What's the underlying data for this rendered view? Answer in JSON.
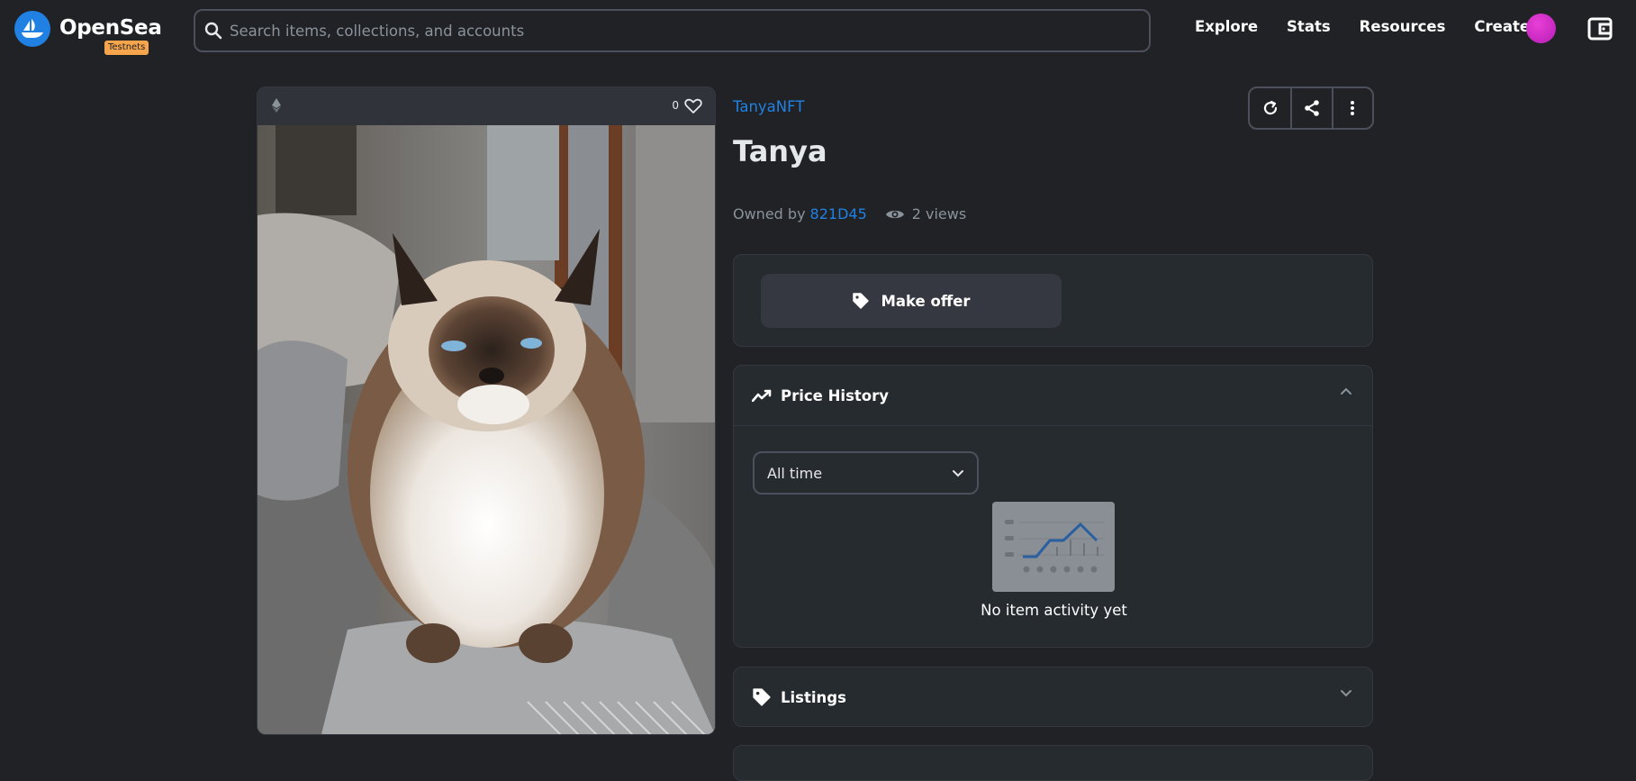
{
  "header": {
    "brand": "OpenSea",
    "badge": "Testnets",
    "search": {
      "placeholder": "Search items, collections, and accounts",
      "value": ""
    },
    "nav": [
      "Explore",
      "Stats",
      "Resources",
      "Create"
    ]
  },
  "item": {
    "favorites_count": "0",
    "collection": "TanyaNFT",
    "title": "Tanya",
    "owned_by_label": "Owned by",
    "owner": "821D45",
    "views": "2 views"
  },
  "offer": {
    "button_label": "Make offer"
  },
  "price_history": {
    "title": "Price History",
    "period_selected": "All time",
    "empty_text": "No item activity yet"
  },
  "listings": {
    "title": "Listings"
  },
  "colors": {
    "background": "#202225",
    "panel": "#262b2f",
    "accent": "#2081e2",
    "badge": "#f6a54c",
    "avatar": "#e93fd8"
  },
  "icons": [
    "search-icon",
    "ethereum-icon",
    "heart-icon",
    "refresh-icon",
    "share-icon",
    "more-vertical-icon",
    "eye-icon",
    "tag-icon",
    "trending-up-icon",
    "chevron-up-icon",
    "chevron-down-icon",
    "wallet-icon"
  ]
}
